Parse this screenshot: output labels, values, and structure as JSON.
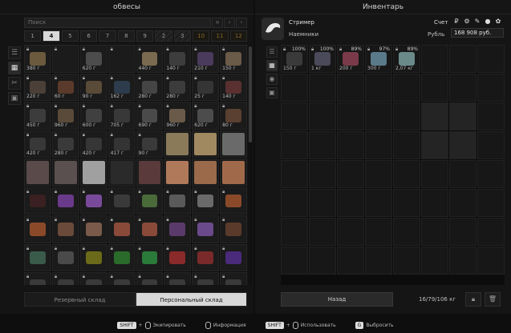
{
  "left_panel": {
    "title": "обвесы",
    "search": {
      "placeholder": "Поиск",
      "value": ""
    },
    "search_buttons": [
      "×",
      "‹",
      "›"
    ],
    "pages": [
      "1",
      "4",
      "5",
      "6",
      "7",
      "8",
      "9",
      "2",
      "3",
      "10",
      "11",
      "12"
    ],
    "active_page": "4",
    "side_tabs": [
      "list-icon",
      "grid-icon",
      "tools-icon",
      "box-icon"
    ],
    "bottom_tabs": [
      "Резервный склад",
      "Персональный склад"
    ],
    "active_bottom_tab": "Персональный склад",
    "items": [
      {
        "price": "380 г",
        "color": "#6b5a3e",
        "face": false
      },
      {
        "price": "",
        "color": "#1b1b1b",
        "face": false
      },
      {
        "price": "620 г",
        "color": "#4c4c4c",
        "face": false
      },
      {
        "price": "",
        "color": "#1b1b1b",
        "face": false
      },
      {
        "price": "440 г",
        "color": "#7a6a50",
        "face": false
      },
      {
        "price": "140 г",
        "color": "#3d3d3d",
        "face": false
      },
      {
        "price": "210 г",
        "color": "#4a3a5c",
        "face": false
      },
      {
        "price": "150 г",
        "color": "#6a5a48",
        "face": false
      },
      {
        "price": "220 г",
        "color": "#4a4038",
        "face": false
      },
      {
        "price": "60 г",
        "color": "#5a3a2a",
        "face": false
      },
      {
        "price": "90 г",
        "color": "#5a4a38",
        "face": false
      },
      {
        "price": "162 г",
        "color": "#2c3c4c",
        "face": false
      },
      {
        "price": "280 г",
        "color": "#454545",
        "face": false
      },
      {
        "price": "280 г",
        "color": "#3c3c3c",
        "face": false
      },
      {
        "price": "25 г",
        "color": "#353535",
        "face": false
      },
      {
        "price": "140 г",
        "color": "#5a3030",
        "face": false
      },
      {
        "price": "450 г",
        "color": "#3c3c3c",
        "face": false
      },
      {
        "price": "960 г",
        "color": "#5a4a3a",
        "face": false
      },
      {
        "price": "600 г",
        "color": "#404040",
        "face": false
      },
      {
        "price": "705 г",
        "color": "#383838",
        "face": false
      },
      {
        "price": "690 г",
        "color": "#4a4a4a",
        "face": false
      },
      {
        "price": "960 г",
        "color": "#6a5a4a",
        "face": false
      },
      {
        "price": "620 г",
        "color": "#4c4c4c",
        "face": false
      },
      {
        "price": "80 г",
        "color": "#5a4030",
        "face": false
      },
      {
        "price": "420 г",
        "color": "#383838",
        "face": false
      },
      {
        "price": "280 г",
        "color": "#3a3a3a",
        "face": false
      },
      {
        "price": "420 г",
        "color": "#363636",
        "face": false
      },
      {
        "price": "417 г",
        "color": "#343434",
        "face": false
      },
      {
        "price": "90 г",
        "color": "#3a3a3a",
        "face": false
      },
      {
        "price": "",
        "color": "#8a7a5a",
        "face": true
      },
      {
        "price": "",
        "color": "#a08860",
        "face": true
      },
      {
        "price": "",
        "color": "#6a6a6a",
        "face": true
      },
      {
        "price": "",
        "color": "#5a4a4a",
        "face": true
      },
      {
        "price": "",
        "color": "#5a5050",
        "face": true
      },
      {
        "price": "",
        "color": "#a0a0a0",
        "face": true
      },
      {
        "price": "",
        "color": "#2a2a2a",
        "face": true
      },
      {
        "price": "",
        "color": "#5a3a3a",
        "face": true
      },
      {
        "price": "",
        "color": "#b07a5a",
        "face": true
      },
      {
        "price": "",
        "color": "#9a6a4a",
        "face": true
      },
      {
        "price": "",
        "color": "#a06a4a",
        "face": true
      },
      {
        "price": "",
        "color": "#3a2020",
        "face": false
      },
      {
        "price": "",
        "color": "#6a3a8a",
        "face": false
      },
      {
        "price": "",
        "color": "#7a4a9a",
        "face": false
      },
      {
        "price": "",
        "color": "#3a3a3a",
        "face": false
      },
      {
        "price": "",
        "color": "#4a6a3a",
        "face": false
      },
      {
        "price": "",
        "color": "#5a5a5a",
        "face": false
      },
      {
        "price": "",
        "color": "#6a6a6a",
        "face": false
      },
      {
        "price": "",
        "color": "#8a4a2a",
        "face": false
      },
      {
        "price": "",
        "color": "#8a4a2a",
        "face": false
      },
      {
        "price": "",
        "color": "#6a4a3a",
        "face": false
      },
      {
        "price": "",
        "color": "#7a5a4a",
        "face": false
      },
      {
        "price": "",
        "color": "#8a4a3a",
        "face": false
      },
      {
        "price": "",
        "color": "#8a4a3a",
        "face": false
      },
      {
        "price": "",
        "color": "#5a3a6a",
        "face": false
      },
      {
        "price": "",
        "color": "#6a4a8a",
        "face": false
      },
      {
        "price": "",
        "color": "#5a3a2a",
        "face": false
      },
      {
        "price": "",
        "color": "#3a5a4a",
        "face": false
      },
      {
        "price": "",
        "color": "#4a4a4a",
        "face": false
      },
      {
        "price": "",
        "color": "#6a6a1a",
        "face": false
      },
      {
        "price": "",
        "color": "#2a6a2a",
        "face": false
      },
      {
        "price": "",
        "color": "#2a7a3a",
        "face": false
      },
      {
        "price": "",
        "color": "#8a2a2a",
        "face": false
      },
      {
        "price": "",
        "color": "#7a2a2a",
        "face": false
      },
      {
        "price": "",
        "color": "#4a2a7a",
        "face": false
      },
      {
        "price": "",
        "color": "#3a3a3a",
        "face": false
      },
      {
        "price": "",
        "color": "#3a3a3a",
        "face": false
      },
      {
        "price": "",
        "color": "#3a3a3a",
        "face": false
      },
      {
        "price": "",
        "color": "#3a3a3a",
        "face": false
      },
      {
        "price": "",
        "color": "#3a3a3a",
        "face": false
      },
      {
        "price": "",
        "color": "#3a3a3a",
        "face": false
      },
      {
        "price": "",
        "color": "#3a3a3a",
        "face": false
      },
      {
        "price": "",
        "color": "#3a3a3a",
        "face": false
      }
    ]
  },
  "right_panel": {
    "title": "Инвентарь",
    "trader": {
      "name": "Стример",
      "subtitle": "Наемники"
    },
    "account_label": "Счет",
    "currency_label": "Рубль",
    "currency_icons": [
      "ruble-icon",
      "euro-icon",
      "dollar-icon",
      "bitcoin-icon",
      "gear-icon"
    ],
    "balance": "168 908 руб.",
    "sell_items": [
      {
        "price": "150 г",
        "pct": "100%",
        "color": "#3a3a3a"
      },
      {
        "price": "1 кг",
        "pct": "100%",
        "color": "#4a4a5a"
      },
      {
        "price": "200 г",
        "pct": "89%",
        "color": "#7a3a4a"
      },
      {
        "price": "300 г",
        "pct": "97%",
        "color": "#5a7a8a"
      },
      {
        "price": "2,07 кг",
        "pct": "89%",
        "color": "#6a8a8a"
      }
    ],
    "back_button": "Назад",
    "weight": "16/79/106 кг"
  },
  "footer": {
    "hints": [
      {
        "key": "SHIFT",
        "mouse": true,
        "label": "Экипировать"
      },
      {
        "key": "",
        "mouse": true,
        "label": "Информация"
      },
      {
        "key": "SHIFT",
        "mouse": true,
        "label": "Использовать"
      },
      {
        "key": "G",
        "mouse": false,
        "label": "Выбросить"
      }
    ]
  }
}
